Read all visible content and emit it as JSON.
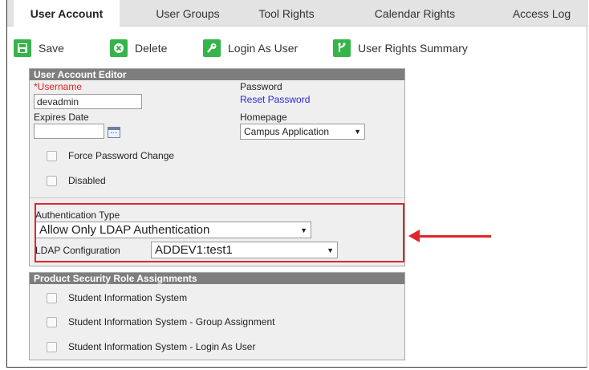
{
  "tabs": [
    {
      "label": "User Account",
      "active": true
    },
    {
      "label": "User Groups",
      "active": false
    },
    {
      "label": "Tool Rights",
      "active": false
    },
    {
      "label": "Calendar Rights",
      "active": false
    },
    {
      "label": "Access Log",
      "active": false
    }
  ],
  "toolbar": {
    "save": "Save",
    "delete": "Delete",
    "login_as_user": "Login As User",
    "rights_summary": "User Rights Summary"
  },
  "editor": {
    "title": "User Account Editor",
    "username_label_req": "*",
    "username_label": "Username",
    "username_value": "devadmin",
    "expires_label": "Expires Date",
    "expires_value": "",
    "password_label": "Password",
    "reset_password": "Reset Password",
    "homepage_label": "Homepage",
    "homepage_value": "Campus Application",
    "force_pw_change": "Force Password Change",
    "disabled": "Disabled",
    "auth_type_label": "Authentication Type",
    "auth_type_value": "Allow Only LDAP Authentication",
    "ldap_label": "LDAP Configuration",
    "ldap_value": "ADDEV1:test1"
  },
  "roles": {
    "title": "Product Security Role Assignments",
    "items": [
      "Student Information System",
      "Student Information System - Group Assignment",
      "Student Information System - Login As User"
    ]
  },
  "colors": {
    "accent_green": "#35b44a",
    "highlight_red": "#e0262a",
    "link_blue": "#2a2ae0",
    "panel_header": "#7e7e7e"
  },
  "icons": {
    "save": "save-icon",
    "delete": "delete-icon",
    "login": "key-icon",
    "summary": "branch-icon"
  }
}
